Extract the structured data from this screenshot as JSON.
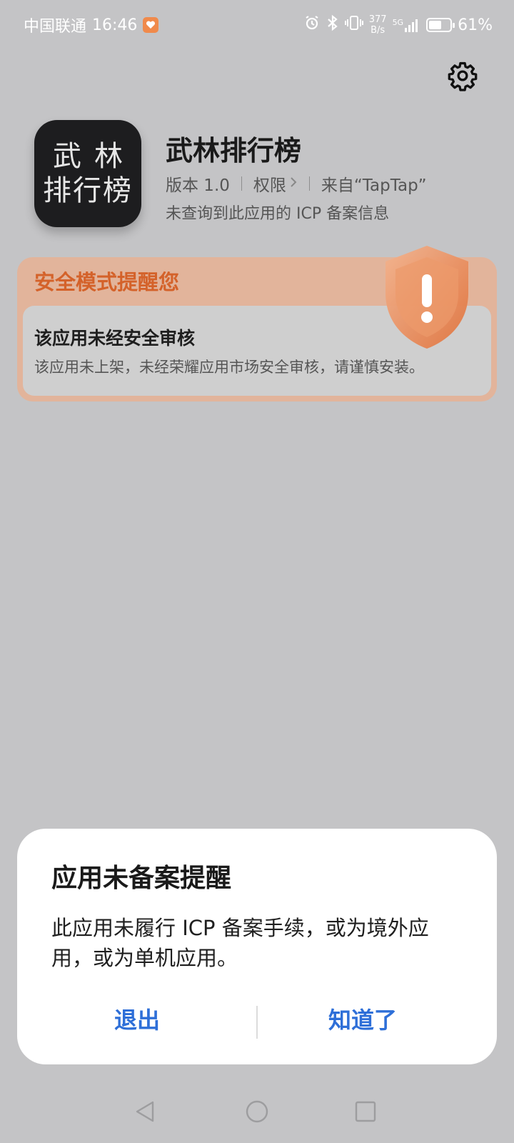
{
  "status_bar": {
    "carrier": "中国联通",
    "time": "16:46",
    "net_speed_value": "377",
    "net_speed_unit": "B/s",
    "network_type": "5G",
    "battery_percent": "61%",
    "battery_level": 0.61
  },
  "app": {
    "icon_line1": "武林",
    "icon_line2": "排行榜",
    "name": "武林排行榜",
    "version": "版本 1.0",
    "permissions": "权限",
    "source": "来自“TapTap”",
    "icp_notice": "未查询到此应用的 ICP 备案信息"
  },
  "safety": {
    "title": "安全模式提醒您",
    "headline": "该应用未经安全审核",
    "description": "该应用未上架，未经荣耀应用市场安全审核，请谨慎安装。"
  },
  "dialog": {
    "title": "应用未备案提醒",
    "message": "此应用未履行 ICP 备案手续，或为境外应用，或为单机应用。",
    "exit_label": "退出",
    "ok_label": "知道了"
  },
  "colors": {
    "accent": "#2e6fd8",
    "warning": "#d4622a",
    "background": "#c4c4c6"
  }
}
